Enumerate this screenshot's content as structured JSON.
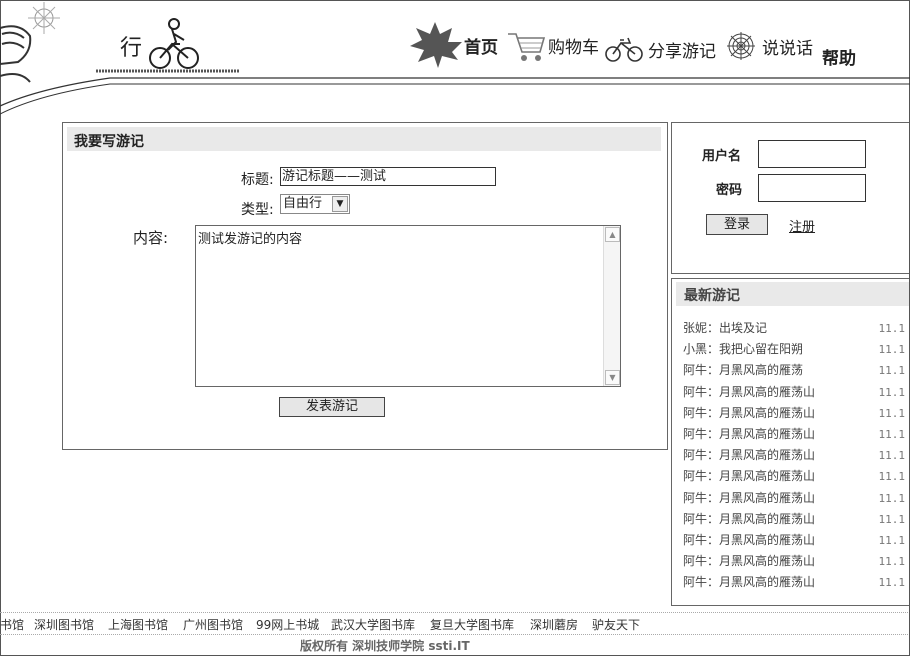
{
  "logo": {
    "char": "行"
  },
  "nav": [
    {
      "label": "首页",
      "icon": "maple-leaf-icon"
    },
    {
      "label": "购物车",
      "icon": "shopping-cart-icon"
    },
    {
      "label": "分享游记",
      "icon": "bicycle-icon"
    },
    {
      "label": "说说话",
      "icon": "spider-web-icon"
    },
    {
      "label": "帮助"
    }
  ],
  "write": {
    "title": "我要写游记",
    "subject_label": "标题:",
    "subject_value": "游记标题——测试",
    "type_label": "类型:",
    "type_value": "自由行",
    "content_label": "内容:",
    "content_value": "测试发游记的内容",
    "submit_label": "发表游记"
  },
  "login": {
    "username_label": "用户名",
    "password_label": "密码",
    "login_button": "登录",
    "register_link": "注册"
  },
  "latest": {
    "title": "最新游记",
    "items": [
      {
        "text": "张妮：出埃及记",
        "date": "11.1"
      },
      {
        "text": "小黑：我把心留在阳朔",
        "date": "11.1"
      },
      {
        "text": "阿牛：月黑风高的雁荡",
        "date": "11.1"
      },
      {
        "text": "阿牛：月黑风高的雁荡山",
        "date": "11.1"
      },
      {
        "text": "阿牛：月黑风高的雁荡山",
        "date": "11.1"
      },
      {
        "text": "阿牛：月黑风高的雁荡山",
        "date": "11.1"
      },
      {
        "text": "阿牛：月黑风高的雁荡山",
        "date": "11.1"
      },
      {
        "text": "阿牛：月黑风高的雁荡山",
        "date": "11.1"
      },
      {
        "text": "阿牛：月黑风高的雁荡山",
        "date": "11.1"
      },
      {
        "text": "阿牛：月黑风高的雁荡山",
        "date": "11.1"
      },
      {
        "text": "阿牛：月黑风高的雁荡山",
        "date": "11.1"
      },
      {
        "text": "阿牛：月黑风高的雁荡山",
        "date": "11.1"
      },
      {
        "text": "阿牛：月黑风高的雁荡山",
        "date": "11.1"
      }
    ]
  },
  "footer": {
    "links": [
      "书馆",
      "深圳图书馆",
      "上海图书馆",
      "广州图书馆",
      "99网上书城",
      "武汉大学图书库",
      "复旦大学图书库",
      "深圳蘑房",
      "驴友天下"
    ],
    "copyright": "版权所有  深圳技师学院  ssti.IT"
  }
}
